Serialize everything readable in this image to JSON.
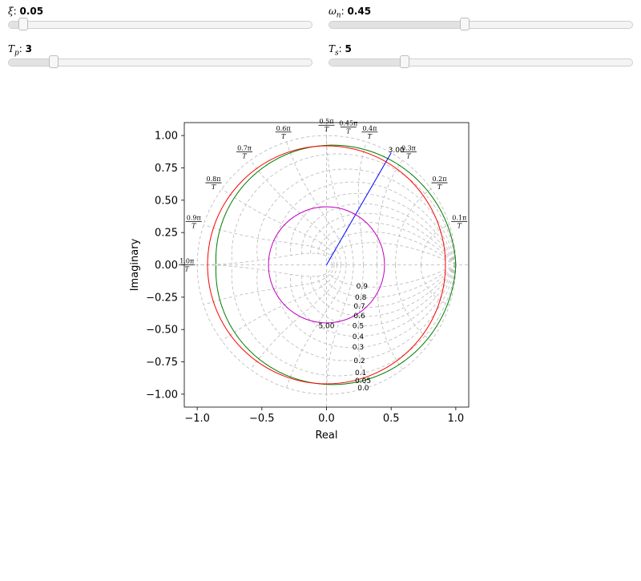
{
  "controls": {
    "xi": {
      "symbol": "ξ",
      "sub": "",
      "value_label": "0.05",
      "fraction": 0.05
    },
    "wn": {
      "symbol": "ω",
      "sub": "n",
      "value_label": "0.45",
      "fraction": 0.45
    },
    "tp": {
      "symbol": "T",
      "sub": "p",
      "value_label": "3",
      "fraction": 0.15
    },
    "ts": {
      "symbol": "T",
      "sub": "s",
      "value_label": "5",
      "fraction": 0.25
    }
  },
  "chart_data": {
    "type": "line",
    "xlabel": "Real",
    "ylabel": "Imaginary",
    "xlim": [
      -1.1,
      1.1
    ],
    "ylim": [
      -1.1,
      1.1
    ],
    "xticks": [
      -1.0,
      -0.5,
      0.0,
      0.5,
      1.0
    ],
    "xtick_labels": [
      "−1.0",
      "−0.5",
      "0.0",
      "0.5",
      "1.0"
    ],
    "yticks": [
      1.0,
      0.75,
      0.5,
      0.25,
      0.0,
      -0.25,
      -0.5,
      -0.75,
      -1.0
    ],
    "ytick_labels": [
      "1.00",
      "0.75",
      "0.50",
      "0.25",
      "0.00",
      "−0.25",
      "−0.50",
      "−0.75",
      "−1.00"
    ],
    "grid": true,
    "damping_grid_values": [
      0.0,
      0.05,
      0.1,
      0.2,
      0.3,
      0.4,
      0.5,
      0.6,
      0.7,
      0.8,
      0.9
    ],
    "damping_labels": [
      "0.0",
      "0.05",
      "0.1",
      "0.2",
      "0.3",
      "0.4",
      "0.5",
      "0.6",
      "0.7",
      "0.8",
      "0.9"
    ],
    "natural_freq_grid": [
      0.1,
      0.2,
      0.3,
      0.4,
      0.5,
      0.6,
      0.7,
      0.8,
      0.9,
      1.0
    ],
    "natural_freq_labels": [
      "0.1π",
      "0.2π",
      "0.3π",
      "0.4π",
      "0.5π",
      "0.6π",
      "0.7π",
      "0.8π",
      "0.9π",
      "1.0π"
    ],
    "freq_label_denominator": "T",
    "extra_label": {
      "text": "0.45π",
      "value": 0.45
    },
    "series": [
      {
        "color": "#008000",
        "kind": "constant-damping",
        "zeta": 0.05
      },
      {
        "color": "#0000ff",
        "kind": "peak-time",
        "radius": 1.0,
        "angle_pi": 0.3333
      },
      {
        "color": "#ff0000",
        "kind": "circle",
        "radius": 0.92
      },
      {
        "color": "#bf00bf",
        "kind": "circle",
        "radius": 0.449
      }
    ],
    "annotations": [
      {
        "text": "3.00",
        "x": 0.54,
        "y": 0.89
      },
      {
        "text": "5.00",
        "x": 0.0,
        "y": -0.47
      }
    ]
  }
}
